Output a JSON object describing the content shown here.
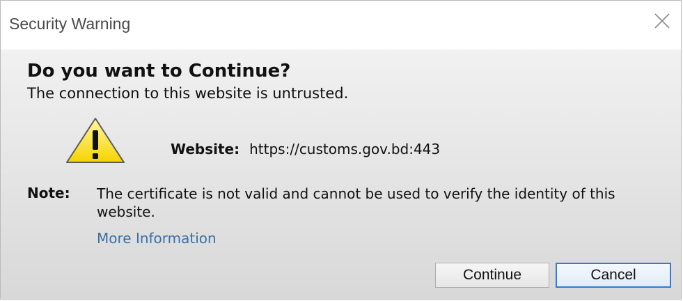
{
  "window": {
    "title": "Security Warning",
    "close_icon": "close-icon"
  },
  "dialog": {
    "heading": "Do you want to Continue?",
    "subheading": "The connection to this website is untrusted.",
    "warning_icon": "warning-triangle-icon",
    "website_label": "Website:",
    "website_url": "https://customs.gov.bd:443",
    "note_label": "Note:",
    "note_text": "The certificate is not valid and cannot be used to verify the identity of this website.",
    "more_info_link": "More Information"
  },
  "buttons": {
    "continue_label": "Continue",
    "cancel_label": "Cancel"
  },
  "colors": {
    "link": "#3d6fa3",
    "focus_border": "#2f7bd6",
    "warning_fill": "#ffe600"
  }
}
